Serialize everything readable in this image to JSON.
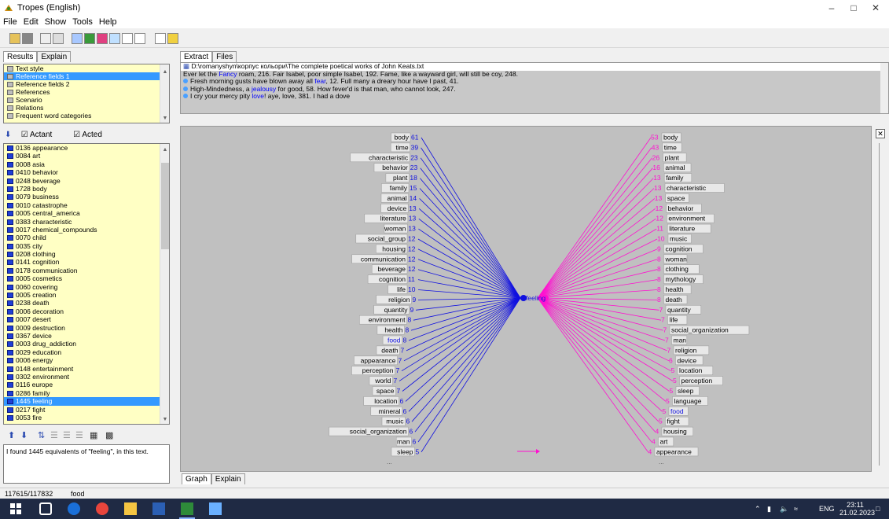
{
  "window": {
    "title": "Tropes (English)"
  },
  "menu": [
    "File",
    "Edit",
    "Show",
    "Tools",
    "Help"
  ],
  "left": {
    "tabs": [
      "Results",
      "Explain"
    ],
    "categories": [
      "Text style",
      "Reference fields 1",
      "Reference fields 2",
      "References",
      "Scenario",
      "Relations",
      "Frequent word categories"
    ],
    "selected_category": "Reference fields 1",
    "actant_label": "Actant",
    "acted_label": "Acted",
    "items": [
      "0136 appearance",
      "0084 art",
      "0008 asia",
      "0410 behavior",
      "0248 beverage",
      "1728 body",
      "0079 business",
      "0010 catastrophe",
      "0005 central_america",
      "0383 characteristic",
      "0017 chemical_compounds",
      "0070 child",
      "0035 city",
      "0208 clothing",
      "0141 cognition",
      "0178 communication",
      "0005 cosmetics",
      "0060 covering",
      "0005 creation",
      "0238 death",
      "0006 decoration",
      "0007 desert",
      "0009 destruction",
      "0367 device",
      "0003 drug_addiction",
      "0029 education",
      "0006 energy",
      "0148 entertainment",
      "0302 environment",
      "0116 europe",
      "0286 family",
      "1445 feeling",
      "0217 fight",
      "0053 fire"
    ],
    "selected_item": "1445 feeling",
    "message": "I found 1445 equivalents of \"feeling\", in this text."
  },
  "right": {
    "tabs": [
      "Extract",
      "Files"
    ],
    "path": "D:\\romanyshyn\\корпус кольори\\The complete poetical works of John Keats.txt",
    "line1": {
      "pre": "Ever let the ",
      "hl": "Fancy",
      "post": " roam, 216. Fair Isabel, poor simple Isabel, 192. Fame, like a wayward girl, will still be coy, 248."
    },
    "line2": {
      "pre": "Fresh morning gusts have blown away all ",
      "hl": "fear",
      "post": ", 12. Full many a dreary hour have I past, 41."
    },
    "line3": {
      "pre": "High-Mindedness, a ",
      "hl": "jealousy",
      "post": " for good, 58. How fever'd is that man,  who cannot look, 247."
    },
    "line4": {
      "pre": "I cry your mercy pity ",
      "hl": "love",
      "post": "! aye, love, 381. I had a dove"
    },
    "bottom_tabs": [
      "Graph",
      "Explain"
    ]
  },
  "graph": {
    "center": "feeling",
    "left_colour": "#1010e0",
    "right_colour": "#ff10d0",
    "left_nodes": [
      {
        "label": "body",
        "count": "61"
      },
      {
        "label": "time",
        "count": "39"
      },
      {
        "label": "characteristic",
        "count": "23"
      },
      {
        "label": "behavior",
        "count": "23"
      },
      {
        "label": "plant",
        "count": "18"
      },
      {
        "label": "family",
        "count": "15"
      },
      {
        "label": "animal",
        "count": "14"
      },
      {
        "label": "device",
        "count": "13"
      },
      {
        "label": "literature",
        "count": "13"
      },
      {
        "label": "woman",
        "count": "13"
      },
      {
        "label": "social_group",
        "count": "12"
      },
      {
        "label": "housing",
        "count": "12"
      },
      {
        "label": "communication",
        "count": "12"
      },
      {
        "label": "beverage",
        "count": "12"
      },
      {
        "label": "cognition",
        "count": "11"
      },
      {
        "label": "life",
        "count": "10"
      },
      {
        "label": "religion",
        "count": "9"
      },
      {
        "label": "quantity",
        "count": "9"
      },
      {
        "label": "environment",
        "count": "8"
      },
      {
        "label": "health",
        "count": "8"
      },
      {
        "label": "food",
        "count": "8"
      },
      {
        "label": "death",
        "count": "7"
      },
      {
        "label": "appearance",
        "count": "7"
      },
      {
        "label": "perception",
        "count": "7"
      },
      {
        "label": "world",
        "count": "7"
      },
      {
        "label": "space",
        "count": "7"
      },
      {
        "label": "location",
        "count": "6"
      },
      {
        "label": "mineral",
        "count": "6"
      },
      {
        "label": "music",
        "count": "6"
      },
      {
        "label": "social_organization",
        "count": "6"
      },
      {
        "label": "man",
        "count": "6"
      },
      {
        "label": "sleep",
        "count": "5"
      }
    ],
    "right_nodes": [
      {
        "label": "body",
        "count": "53"
      },
      {
        "label": "time",
        "count": "43"
      },
      {
        "label": "plant",
        "count": "26"
      },
      {
        "label": "animal",
        "count": "16"
      },
      {
        "label": "family",
        "count": "13"
      },
      {
        "label": "characteristic",
        "count": "13"
      },
      {
        "label": "space",
        "count": "13"
      },
      {
        "label": "behavior",
        "count": "12"
      },
      {
        "label": "environment",
        "count": "12"
      },
      {
        "label": "literature",
        "count": "11"
      },
      {
        "label": "music",
        "count": "10"
      },
      {
        "label": "cognition",
        "count": "9"
      },
      {
        "label": "woman",
        "count": "8"
      },
      {
        "label": "clothing",
        "count": "8"
      },
      {
        "label": "mythology",
        "count": "8"
      },
      {
        "label": "health",
        "count": "8"
      },
      {
        "label": "death",
        "count": "8"
      },
      {
        "label": "quantity",
        "count": "7"
      },
      {
        "label": "life",
        "count": "7"
      },
      {
        "label": "social_organization",
        "count": "7"
      },
      {
        "label": "man",
        "count": "7"
      },
      {
        "label": "religion",
        "count": "7"
      },
      {
        "label": "device",
        "count": "6"
      },
      {
        "label": "location",
        "count": "5"
      },
      {
        "label": "perception",
        "count": "5"
      },
      {
        "label": "sleep",
        "count": "5"
      },
      {
        "label": "language",
        "count": "5"
      },
      {
        "label": "food",
        "count": "5"
      },
      {
        "label": "fight",
        "count": "5"
      },
      {
        "label": "housing",
        "count": "4"
      },
      {
        "label": "art",
        "count": "4"
      },
      {
        "label": "appearance",
        "count": "4"
      }
    ],
    "left_highlighted": [
      "food"
    ],
    "right_highlighted": [
      "food"
    ],
    "more": "..."
  },
  "status": {
    "position": "117615/117832",
    "word": "food"
  },
  "tray": {
    "lang": "ENG",
    "time": "23:11",
    "date": "21.02.2023"
  }
}
